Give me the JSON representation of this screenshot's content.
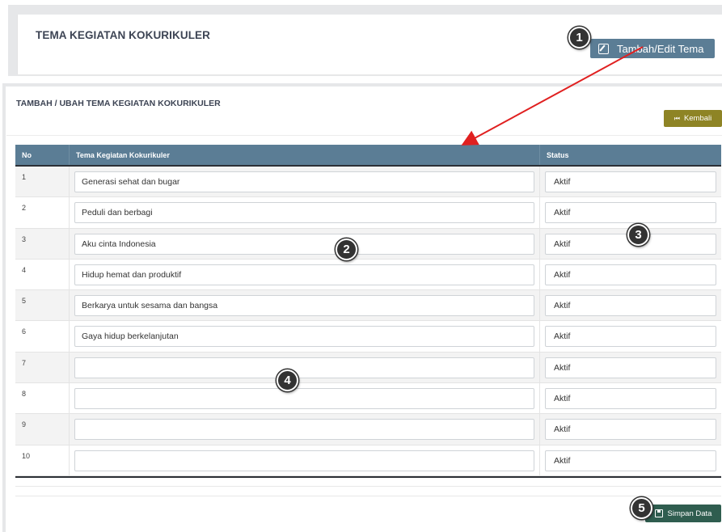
{
  "top_panel": {
    "title": "TEMA KEGIATAN KOKURIKULER",
    "tambah_button": "Tambah/Edit Tema"
  },
  "form_panel": {
    "title": "TAMBAH / UBAH TEMA KEGIATAN KOKURIKULER",
    "kembali_button": "Kembali",
    "simpan_button": "Simpan Data"
  },
  "table": {
    "headers": [
      "No",
      "Tema Kegiatan Kokurikuler",
      "Status"
    ],
    "rows": [
      {
        "no": "1",
        "tema": "Generasi sehat dan bugar",
        "status": "Aktif"
      },
      {
        "no": "2",
        "tema": "Peduli dan berbagi",
        "status": "Aktif"
      },
      {
        "no": "3",
        "tema": "Aku cinta Indonesia",
        "status": "Aktif"
      },
      {
        "no": "4",
        "tema": "Hidup hemat dan produktif",
        "status": "Aktif"
      },
      {
        "no": "5",
        "tema": "Berkarya untuk sesama dan bangsa",
        "status": "Aktif"
      },
      {
        "no": "6",
        "tema": "Gaya hidup berkelanjutan",
        "status": "Aktif"
      },
      {
        "no": "7",
        "tema": "",
        "status": "Aktif"
      },
      {
        "no": "8",
        "tema": "",
        "status": "Aktif"
      },
      {
        "no": "9",
        "tema": "",
        "status": "Aktif"
      },
      {
        "no": "10",
        "tema": "",
        "status": "Aktif"
      }
    ]
  },
  "markers": [
    "1",
    "2",
    "3",
    "4",
    "5"
  ],
  "colors": {
    "header_bg": "#5b7d95",
    "kembali_bg": "#8e8425",
    "simpan_bg": "#2f5d4f",
    "arrow": "#e02020"
  },
  "icons": {
    "tambah": "edit-icon",
    "kembali": "skip-back-icon",
    "simpan": "save-icon"
  }
}
